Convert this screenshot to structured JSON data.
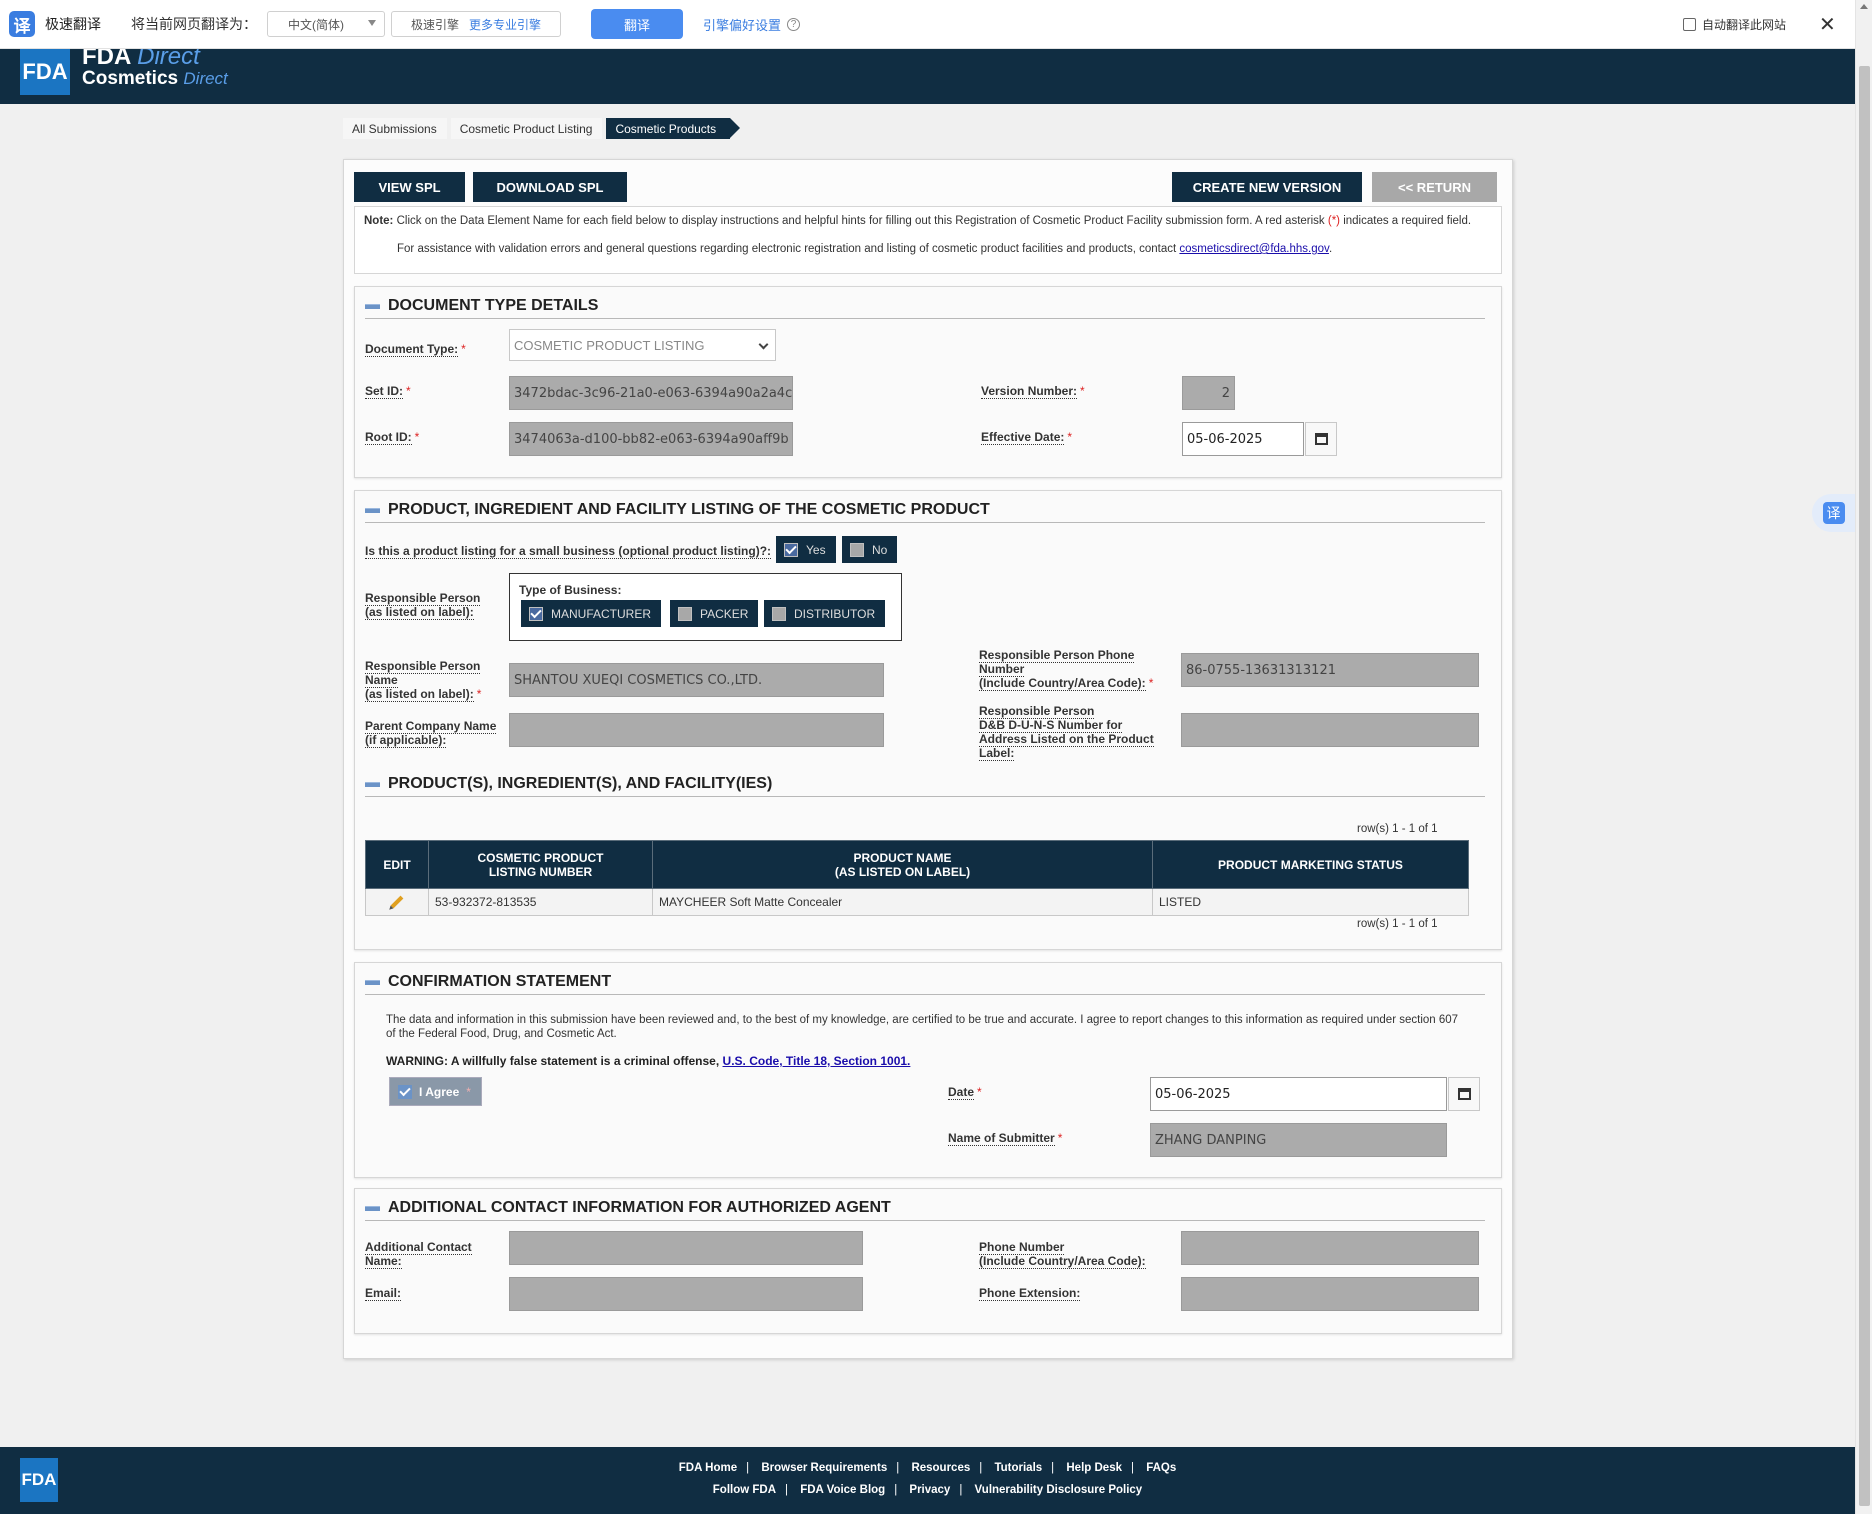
{
  "toolbar": {
    "logo_glyph": "译",
    "name": "极速翻译",
    "translate_to_label": "将当前网页翻译为：",
    "language_value": "中文(简体)",
    "engine_label": "极速引擎",
    "engine_more": "更多专业引擎",
    "translate_button": "翻译",
    "preferences_link": "引擎偏好设置",
    "help_glyph": "?",
    "auto_translate_label": "自动翻译此网站",
    "close_glyph": "✕"
  },
  "header": {
    "logo_text": "FDA",
    "line1_bold": "FDA",
    "line1_light": "Direct",
    "line2_bold": "Cosmetics",
    "line2_light": "Direct"
  },
  "floating_translate_glyph": "译",
  "breadcrumb": [
    "All Submissions",
    "Cosmetic Product Listing",
    "Cosmetic Products"
  ],
  "actions": {
    "view_spl": "VIEW SPL",
    "download_spl": "DOWNLOAD SPL",
    "create_new_version": "CREATE NEW VERSION",
    "return": "<< RETURN"
  },
  "note": {
    "label": "Note:",
    "text_before": " Click on the Data Element Name for each field below to display instructions and helpful hints for filling out this Registration of Cosmetic Product Facility submission form. A red asterisk ",
    "asterisk": "(*)",
    "text_after": " indicates a required field.",
    "assistance": "For assistance with validation errors and general questions regarding electronic registration and listing of cosmetic product facilities and products, contact ",
    "email": "cosmeticsdirect@fda.hhs.gov",
    "period": "."
  },
  "document_type_details": {
    "title": "DOCUMENT TYPE DETAILS",
    "document_type_label": "Document Type:",
    "document_type_value": "COSMETIC PRODUCT LISTING",
    "set_id_label": "Set ID:",
    "set_id_value": "3472bdac-3c96-21a0-e063-6394a90a2a4c",
    "root_id_label": "Root ID:",
    "root_id_value": "3474063a-d100-bb82-e063-6394a90aff9b",
    "version_number_label": "Version Number:",
    "version_number_value": "2",
    "effective_date_label": "Effective Date:",
    "effective_date_value": "05-06-2025"
  },
  "product_listing": {
    "title": "PRODUCT, INGREDIENT AND FACILITY LISTING OF THE COSMETIC PRODUCT",
    "small_business_label": "Is this a product listing for a small business (optional product listing)?:",
    "yes_label": "Yes",
    "no_label": "No",
    "responsible_person_label_1": "Responsible Person",
    "responsible_person_label_2": "(as listed on label):",
    "type_of_business_label": "Type of Business:",
    "manufacturer_label": "MANUFACTURER",
    "packer_label": "PACKER",
    "distributor_label": "DISTRIBUTOR",
    "rp_name_label_1": "Responsible Person",
    "rp_name_label_2": "Name",
    "rp_name_label_3": "(as listed on label):",
    "rp_name_value": "SHANTOU XUEQI COSMETICS CO.,LTD.",
    "rp_phone_label_1": "Responsible Person Phone",
    "rp_phone_label_2": "Number",
    "rp_phone_label_3": "(Include Country/Area Code):",
    "rp_phone_value": "86-0755-13631313121",
    "parent_company_label_1": "Parent Company Name",
    "parent_company_label_2": "(if applicable):",
    "parent_company_value": "",
    "duns_label_1": "Responsible Person",
    "duns_label_2": "D&B D-U-N-S Number for",
    "duns_label_3": "Address Listed on the Product",
    "duns_label_4": "Label:",
    "duns_value": ""
  },
  "products": {
    "title": "PRODUCT(S), INGREDIENT(S), AND FACILITY(IES)",
    "rows_text_top": "row(s) 1 - 1 of 1",
    "rows_text_bottom": "row(s) 1 - 1 of 1",
    "columns": [
      "EDIT",
      "COSMETIC PRODUCT|LISTING NUMBER",
      "PRODUCT NAME|(AS LISTED ON LABEL)",
      "PRODUCT MARKETING STATUS"
    ],
    "col_edit": "EDIT",
    "col_listing_1": "COSMETIC PRODUCT",
    "col_listing_2": "LISTING NUMBER",
    "col_name_1": "PRODUCT NAME",
    "col_name_2": "(AS LISTED ON LABEL)",
    "col_status": "PRODUCT MARKETING STATUS",
    "rows": [
      {
        "listing_number": "53-932372-813535",
        "product_name": "MAYCHEER Soft Matte Concealer",
        "status": "LISTED"
      }
    ]
  },
  "confirmation": {
    "title": "CONFIRMATION STATEMENT",
    "statement": "The data and information in this submission have been reviewed and, to the best of my knowledge, are certified to be true and accurate. I agree to report changes to this information as required under section 607 of the Federal Food, Drug, and Cosmetic Act.",
    "warning": "WARNING: A willfully false statement is a criminal offense, ",
    "warning_link": "U.S. Code, Title 18, Section 1001.",
    "agree_label": "I Agree",
    "date_label": "Date",
    "date_value": "05-06-2025",
    "submitter_label": "Name of Submitter",
    "submitter_value": "ZHANG DANPING"
  },
  "additional_contact": {
    "title": "ADDITIONAL CONTACT INFORMATION FOR AUTHORIZED AGENT",
    "contact_name_label_1": "Additional Contact",
    "contact_name_label_2": "Name:",
    "contact_name_value": "",
    "email_label": "Email:",
    "email_value": "",
    "phone_label_1": "Phone Number",
    "phone_label_2": "(Include Country/Area Code):",
    "phone_value": "",
    "extension_label": "Phone Extension:",
    "extension_value": ""
  },
  "footer": {
    "logo_text": "FDA",
    "row1": [
      "FDA Home",
      "Browser Requirements",
      "Resources",
      "Tutorials",
      "Help Desk",
      "FAQs"
    ],
    "row2": [
      "Follow FDA",
      "FDA Voice Blog",
      "Privacy",
      "Vulnerability Disclosure Policy"
    ],
    "separator": "|"
  },
  "colors": {
    "navy": "#102d42",
    "fda_blue": "#1b75c2",
    "link": "#1a0dab",
    "required_red": "#d22222",
    "translate_blue": "#4a8cf0"
  }
}
